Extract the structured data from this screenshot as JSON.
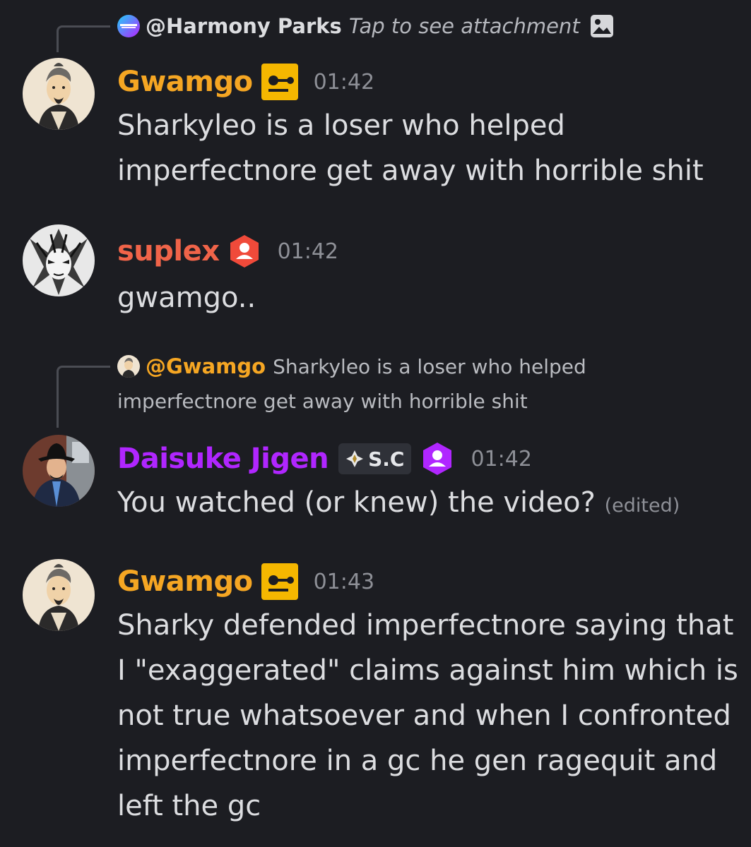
{
  "messages": [
    {
      "reply": {
        "author": "@Harmony Parks",
        "preview": "Tap to see attachment",
        "icon": "image-icon"
      },
      "author": "Gwamgo",
      "author_color": "#f5a623",
      "badge_icon": "sleepy-face-icon",
      "time": "01:42",
      "lines": [
        "Sharkyleo is a loser who helped",
        "imperfectnore get away with horrible shit"
      ]
    },
    {
      "author": "suplex",
      "author_color": "#f06449",
      "badge_icon": "person-hexagon-icon",
      "time": "01:42",
      "lines": [
        "gwamgo.."
      ]
    },
    {
      "reply": {
        "author": "@Gwamgo",
        "preview_line1": "Sharkyleo is a loser who helped",
        "preview_line2": "imperfectnore get away with horrible shit"
      },
      "author": "Daisuke Jigen",
      "author_color": "#b026ff",
      "tag": "S.C",
      "badge_icon": "person-hexagon-icon",
      "time": "01:42",
      "text": "You watched (or knew) the video?",
      "edited": "(edited)"
    },
    {
      "author": "Gwamgo",
      "author_color": "#f5a623",
      "badge_icon": "sleepy-face-icon",
      "time": "01:43",
      "lines": [
        "Sharky defended imperfectnore saying that",
        "I \"exaggerated\" claims against him which is",
        "not true whatsoever and when I confronted",
        "imperfectnore in a gc he gen ragequit and",
        "left the gc"
      ]
    }
  ]
}
